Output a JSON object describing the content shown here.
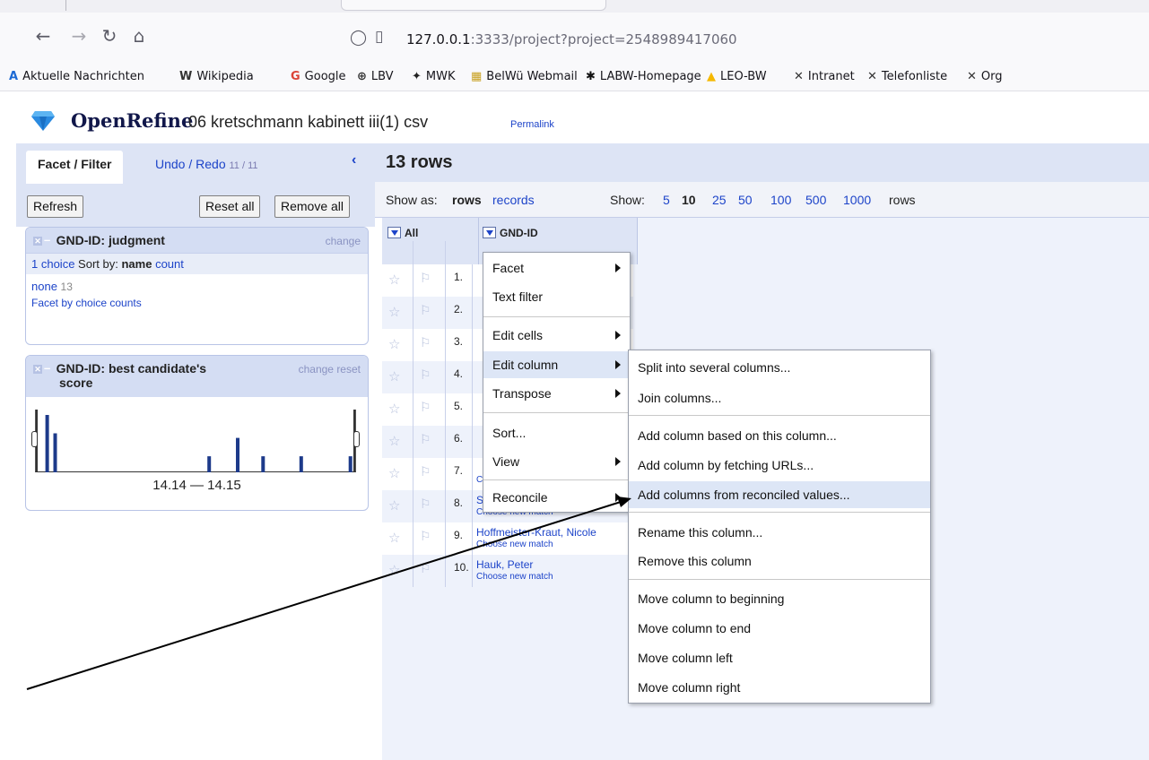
{
  "browser": {
    "url_host": "127.0.0.1",
    "url_rest": ":3333/project?project=2548989417060",
    "bookmarks": [
      {
        "label": "Aktuelle Nachrichten",
        "icon": "A"
      },
      {
        "label": "Wikipedia",
        "icon": "W"
      },
      {
        "label": "Google",
        "icon": "G"
      },
      {
        "label": "LBV",
        "icon": "⊕"
      },
      {
        "label": "MWK",
        "icon": "✦"
      },
      {
        "label": "BelWü Webmail",
        "icon": "▦"
      },
      {
        "label": "LABW-Homepage",
        "icon": "✱"
      },
      {
        "label": "LEO-BW",
        "icon": "▲"
      },
      {
        "label": "Intranet",
        "icon": "✕"
      },
      {
        "label": "Telefonliste",
        "icon": "✕"
      },
      {
        "label": "Org",
        "icon": "✕"
      }
    ]
  },
  "app": {
    "brand": "OpenRefine",
    "project_name": "06 kretschmann kabinett iii(1) csv",
    "permalink": "Permalink"
  },
  "left": {
    "tab_facet": "Facet / Filter",
    "tab_undo": "Undo / Redo",
    "undo_count": "11 / 11",
    "refresh": "Refresh",
    "reset_all": "Reset all",
    "remove_all": "Remove all",
    "facet1": {
      "title": "GND-ID: judgment",
      "change": "change",
      "choices": "1 choice",
      "sort_by": "Sort by:",
      "sort_name": "name",
      "sort_count": "count",
      "choice_label": "none",
      "choice_count": "13",
      "footer": "Facet by choice counts"
    },
    "facet2": {
      "title": "GND-ID: best candidate's",
      "title2": "score",
      "change": "change",
      "reset": "reset",
      "range": "14.14 — 14.15"
    }
  },
  "histogram_bars": [
    {
      "pos": 0.03,
      "value": 1.0
    },
    {
      "pos": 0.055,
      "value": 0.68
    },
    {
      "pos": 0.54,
      "value": 0.28
    },
    {
      "pos": 0.63,
      "value": 0.6
    },
    {
      "pos": 0.71,
      "value": 0.28
    },
    {
      "pos": 0.83,
      "value": 0.28
    },
    {
      "pos": 0.985,
      "value": 0.28
    }
  ],
  "right": {
    "rows_title": "13 rows",
    "show_as": "Show as:",
    "rows_mode": "rows",
    "records_mode": "records",
    "show": "Show:",
    "page_sizes": [
      "5",
      "10",
      "25",
      "50",
      "100",
      "500",
      "1000"
    ],
    "rows_suffix": "rows",
    "col_all": "All",
    "col_gnd": "GND-ID"
  },
  "rows": [
    {
      "num": "1.",
      "value": "",
      "sub": ""
    },
    {
      "num": "2.",
      "value": "",
      "sub": ""
    },
    {
      "num": "3.",
      "value": "",
      "sub": ""
    },
    {
      "num": "4.",
      "value": "",
      "sub": ""
    },
    {
      "num": "5.",
      "value": "",
      "sub": ""
    },
    {
      "num": "6.",
      "value": "",
      "sub": ""
    },
    {
      "num": "7.",
      "value": "",
      "sub": "Choose new match"
    },
    {
      "num": "8.",
      "value": "Strobl, Thomas",
      "sub": "Choose new match"
    },
    {
      "num": "9.",
      "value": "Hoffmeister-Kraut, Nicole",
      "sub": "Choose new match"
    },
    {
      "num": "10.",
      "value": "Hauk, Peter",
      "sub": "Choose new match"
    }
  ],
  "column_menu": {
    "facet": "Facet",
    "text_filter": "Text filter",
    "edit_cells": "Edit cells",
    "edit_column": "Edit column",
    "transpose": "Transpose",
    "sort": "Sort...",
    "view": "View",
    "reconcile": "Reconcile"
  },
  "edit_column_menu": {
    "split": "Split into several columns...",
    "join": "Join columns...",
    "add_based": "Add column based on this column...",
    "add_fetch": "Add column by fetching URLs...",
    "add_reconciled": "Add columns from reconciled values...",
    "rename": "Rename this column...",
    "remove": "Remove this column",
    "move_begin": "Move column to beginning",
    "move_end": "Move column to end",
    "move_left": "Move column left",
    "move_right": "Move column right"
  },
  "colors": {
    "accent": "#1d44c9",
    "panel": "#dde4f5",
    "bar": "#1d3a8a"
  }
}
